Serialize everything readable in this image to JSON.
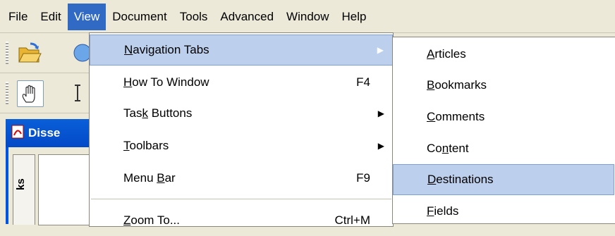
{
  "menubar": {
    "items": [
      {
        "label": "File"
      },
      {
        "label": "Edit"
      },
      {
        "label": "View",
        "active": true
      },
      {
        "label": "Document"
      },
      {
        "label": "Tools"
      },
      {
        "label": "Advanced"
      },
      {
        "label": "Window"
      },
      {
        "label": "Help"
      }
    ]
  },
  "document_window": {
    "title": "Disse",
    "nav_tab_label": "ks"
  },
  "view_menu": {
    "items": [
      {
        "pre": "",
        "key": "N",
        "post": "avigation Tabs",
        "shortcut": "",
        "submenu": true,
        "highlight": true
      },
      {
        "pre": "",
        "key": "H",
        "post": "ow To Window",
        "shortcut": "F4",
        "submenu": false
      },
      {
        "pre": "Tas",
        "key": "k",
        "post": " Buttons",
        "shortcut": "",
        "submenu": true
      },
      {
        "pre": "",
        "key": "T",
        "post": "oolbars",
        "shortcut": "",
        "submenu": true
      },
      {
        "pre": "Menu ",
        "key": "B",
        "post": "ar",
        "shortcut": "F9",
        "submenu": false
      },
      {
        "pre": "",
        "key": "Z",
        "post": "oom To...",
        "shortcut": "Ctrl+M",
        "submenu": false
      }
    ]
  },
  "nav_submenu": {
    "items": [
      {
        "pre": "",
        "key": "A",
        "post": "rticles"
      },
      {
        "pre": "",
        "key": "B",
        "post": "ookmarks"
      },
      {
        "pre": "",
        "key": "C",
        "post": "omments"
      },
      {
        "pre": "Co",
        "key": "n",
        "post": "tent"
      },
      {
        "pre": "",
        "key": "D",
        "post": "estinations",
        "highlight": true
      },
      {
        "pre": "",
        "key": "F",
        "post": "ields"
      }
    ]
  },
  "colors": {
    "menu_highlight": "#bcd0ee",
    "menubar_active": "#316ac5",
    "chrome": "#ece9d8"
  }
}
